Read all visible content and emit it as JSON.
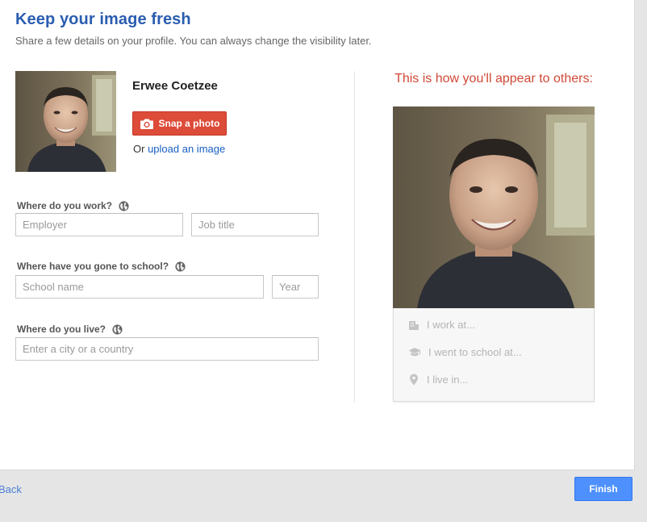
{
  "header": {
    "title": "Keep your image fresh",
    "subtitle": "Share a few details on your profile. You can always change the visibility later."
  },
  "profile": {
    "name": "Erwee Coetzee",
    "snap_label": "Snap a photo",
    "upload_prefix": "Or",
    "upload_link": "upload an image"
  },
  "work": {
    "label": "Where do you work?",
    "employer_placeholder": "Employer",
    "job_placeholder": "Job title"
  },
  "school": {
    "label": "Where have you gone to school?",
    "school_placeholder": "School name",
    "year_placeholder": "Year"
  },
  "live": {
    "label": "Where do you live?",
    "location_placeholder": "Enter a city or a country"
  },
  "preview": {
    "title": "This is how you'll appear to others:",
    "work_text": "I work at...",
    "school_text": "I went to school at...",
    "live_text": "I live in..."
  },
  "footer": {
    "back_label": "Back",
    "finish_label": "Finish"
  },
  "colors": {
    "title": "#2a5db0",
    "snap_button": "#dd4b39",
    "preview_title": "#d14836",
    "finish_button": "#4d90fe",
    "link": "#1a5fc4"
  },
  "icons": {
    "snap": "camera-icon",
    "visibility": "globe-icon",
    "work": "building-icon",
    "school": "graduation-cap-icon",
    "live": "location-pin-icon"
  }
}
